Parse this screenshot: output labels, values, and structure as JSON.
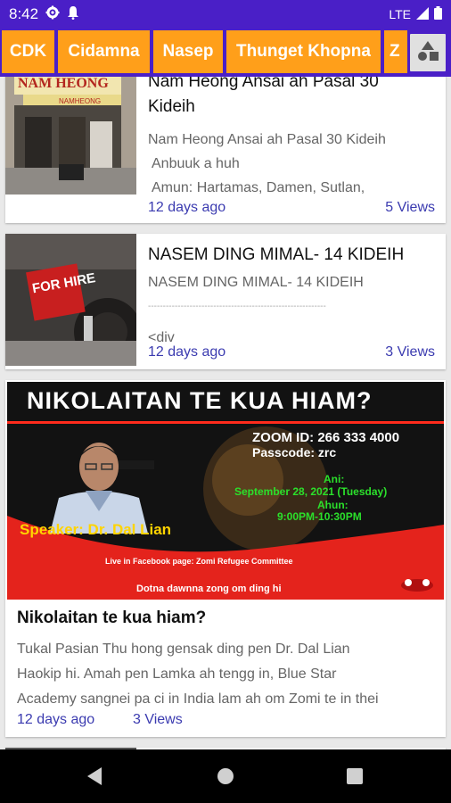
{
  "status": {
    "time": "8:42",
    "network": "LTE"
  },
  "tabs": [
    "CDK",
    "Cidamna",
    "Nasep",
    "Thunget Khopna",
    "Z"
  ],
  "cards": [
    {
      "title_line1": "Nam Heong Ansai ah Pasal 30",
      "title_line2": "Kideih",
      "desc_lines": [
        "Nam Heong Ansai ah Pasal 30 Kideih",
        "Anbuuk a huh",
        "Amun: Hartamas, Damen, Sutlan,"
      ],
      "time": "12 days ago",
      "views": "5 Views",
      "thumb_sign": "NAM HEONG",
      "thumb_sign_small": "NAMHEONG"
    },
    {
      "title_line1": "NASEM DING MIMAL- 14 KIDEIH",
      "desc_lines": [
        "NASEM DING MIMAL- 14 KIDEIH",
        "------------------------------------------------------------",
        "<div"
      ],
      "time": "12 days ago",
      "views": "3 Views",
      "thumb_sign": "FOR HIRE"
    },
    {
      "banner": {
        "headline": "NIKOLAITAN TE KUA HIAM?",
        "zoom_id": "ZOOM ID: 266 333 4000",
        "passcode": "Passcode: zrc",
        "ani_label": "Ani:",
        "date": "September 28, 2021 (Tuesday)",
        "ahun_label": "Ahun:",
        "time_range": "9:00PM-10:30PM",
        "speaker": "Speaker: Dr. Dal Lian",
        "live": "Live in Facebook page: Zomi Refugee Committee",
        "footer": "Dotna dawnna zong om ding hi"
      },
      "title": "Nikolaitan te kua hiam?",
      "desc_lines": [
        "Tukal Pasian Thu hong gensak ding pen Dr. Dal Lian",
        "Haokip hi. Amah pen Lamka ah tengg in, Blue Star",
        "Academy sangnei pa ci in India lam ah om Zomi te in thei"
      ],
      "time": "12 days ago",
      "views": "3 Views"
    }
  ],
  "colors": {
    "primary": "#4a1fc7",
    "accent": "#ff9f1a",
    "link": "#3b3bb0"
  }
}
